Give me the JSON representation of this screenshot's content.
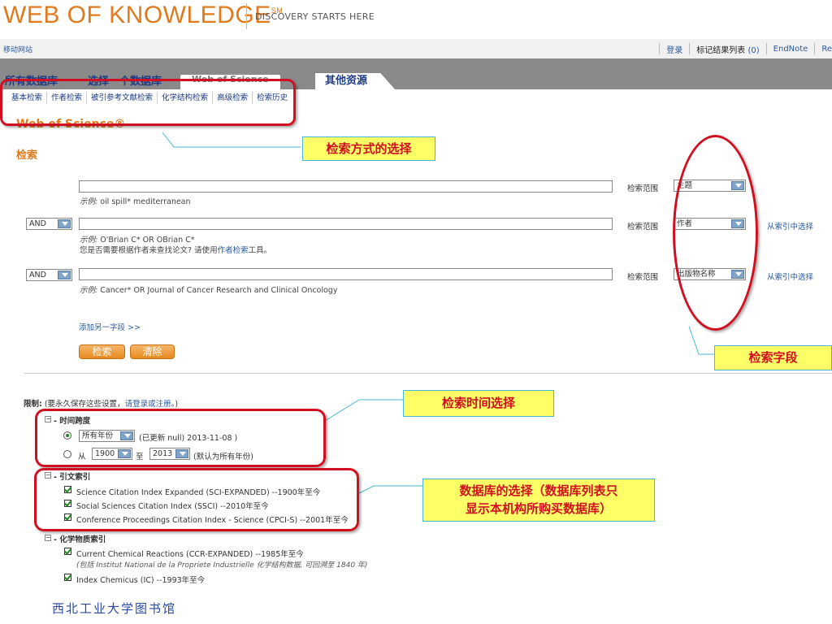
{
  "header": {
    "logo_text": "WEB OF KNOWLEDGE",
    "logo_mark": "SM",
    "tagline": "DISCOVERY STARTS HERE",
    "mobile_site": "移动网站",
    "util_nav": {
      "login": "登录",
      "marked_list": "标记结果列表",
      "marked_count": "(0)",
      "endnote": "EndNote",
      "partial": "Re"
    }
  },
  "tabs": {
    "all_databases": "所有数据库",
    "select_database": "选择一个数据库",
    "web_of_science": "Web of Science",
    "other_resources": "其他资源"
  },
  "subtabs": [
    "基本检索",
    "作者检索",
    "被引参考文献检索",
    "化学结构检索",
    "高级检索",
    "检索历史"
  ],
  "page": {
    "wos_heading": "Web of Science®",
    "search_heading": "检索"
  },
  "search_rows": [
    {
      "operator": "",
      "value": "",
      "example_label": "示例:",
      "example": "oil spill* mediterranean",
      "hint_prefix": "",
      "hint_link": "",
      "hint_suffix": "",
      "scope_label": "检索范围",
      "scope": "主题",
      "from_index": ""
    },
    {
      "operator": "AND",
      "value": "",
      "example_label": "示例:",
      "example": "O'Brian C* OR OBrian C*",
      "hint_prefix": "您是否需要根据作者来查找论文? 请使用",
      "hint_link": "作者检索",
      "hint_suffix": "工具。",
      "scope_label": "检索范围",
      "scope": "作者",
      "from_index": "从索引中选择"
    },
    {
      "operator": "AND",
      "value": "",
      "example_label": "示例:",
      "example": "Cancer* OR Journal of Cancer Research and Clinical Oncology",
      "hint_prefix": "",
      "hint_link": "",
      "hint_suffix": "",
      "scope_label": "检索范围",
      "scope": "出版物名称",
      "from_index": "从索引中选择"
    }
  ],
  "add_field": "添加另一字段 >>",
  "buttons": {
    "search": "检索",
    "clear": "清除"
  },
  "limits": {
    "label": "限制:",
    "note_prefix": "(要永久保存这些设置，",
    "note_link": "请登录或注册。",
    "note_suffix": ")",
    "timespan": {
      "title": "时间跨度",
      "option1_select": "所有年份",
      "option1_note": "(已更新  null) 2013-11-08 )",
      "from_label": "从",
      "from_year": "1900",
      "to_label": "至",
      "to_year": "2013",
      "option2_note": "(默认为所有年份)"
    },
    "citation_index": {
      "title": "引文索引",
      "items": [
        "Science Citation Index Expanded (SCI-EXPANDED) --1900年至今",
        "Social Sciences Citation Index (SSCI) --2010年至今",
        "Conference Proceedings Citation Index - Science (CPCI-S) --2001年至今"
      ]
    },
    "chemical_index": {
      "title": "化学物质索引",
      "item1": "Current Chemical Reactions (CCR-EXPANDED) --1985年至今",
      "item1_note": "(包括 Institut National de la Propriete Industrielle 化学结构数据, 可回溯至 1840 年)",
      "item2": "Index Chemicus (IC) --1993年至今"
    }
  },
  "annotations": {
    "search_method": "检索方式的选择",
    "search_fields": "检索字段",
    "time_selection": "检索时间选择",
    "database_selection_line1": "数据库的选择（数据库列表只",
    "database_selection_line2": "显示本机构所购买数据库）"
  },
  "footer": "西北工业大学图书馆",
  "colors": {
    "brand_orange": "#e07a1c",
    "link_blue": "#2a5aa0",
    "annotation_red": "#d01020",
    "callout_yellow": "#ffff66"
  }
}
